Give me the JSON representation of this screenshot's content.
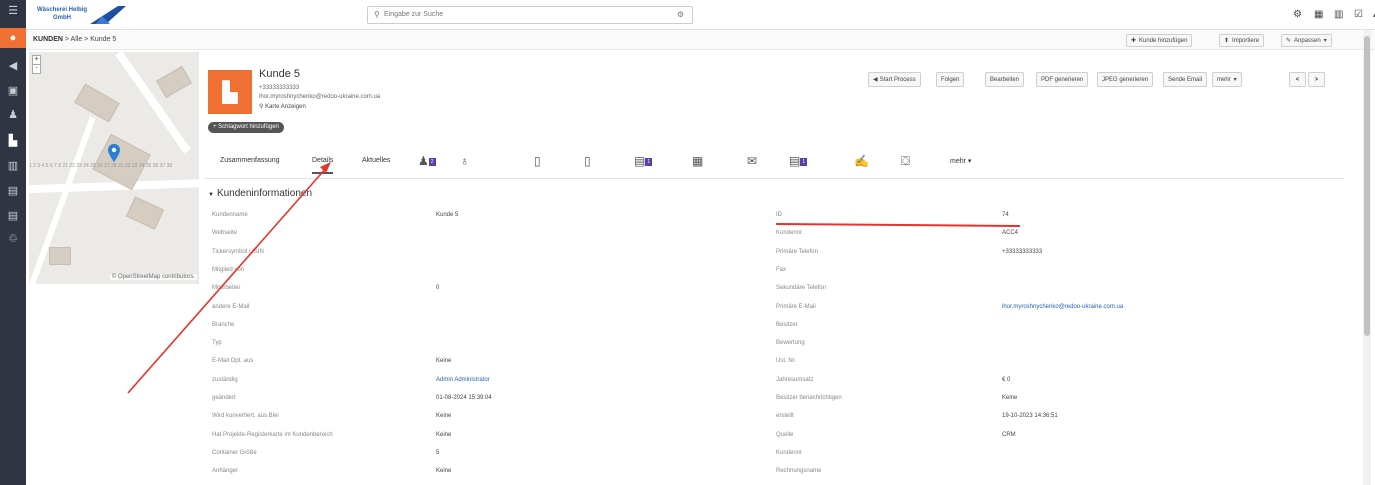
{
  "brand": {
    "line1": "Wäscherei Helbig",
    "line2": "GmbH"
  },
  "search": {
    "placeholder": "Eingabe zur Suche"
  },
  "breadcrumb": {
    "module": "KUNDEN",
    "path": "> Alle > Kunde 5"
  },
  "toolbar": {
    "add": "Kunde hinzufügen",
    "import": "Importiere",
    "customize": "Anpassen"
  },
  "map": {
    "attribution": "© OpenStreetMap contributors.",
    "zoom_in": "+",
    "zoom_out": "-"
  },
  "record": {
    "name": "Kunde 5",
    "phone": "+33333333333",
    "email": "ihor.myroshnychenko@redoo-ukraine.com.ua",
    "map_link": "Karte Anzeigen",
    "tag_button": "+ Schlagwort hinzufügen"
  },
  "actions": {
    "start_process": "Start Process",
    "follow": "Folgen",
    "edit": "Bearbeiten",
    "pdf": "PDF generieren",
    "jpeg": "JPEG generieren",
    "send_email": "Sende Email",
    "more": "mehr"
  },
  "tabs": {
    "summary": "Zusammenfassung",
    "details": "Details",
    "updates": "Aktuelles",
    "more": "mehr",
    "badge1": "2",
    "badge2": "1",
    "badge3": "1"
  },
  "section": {
    "title": "Kundeninformationen"
  },
  "fields_left": [
    {
      "label": "Kundenname",
      "value": "Kunde 5"
    },
    {
      "label": "Webseite",
      "value": ""
    },
    {
      "label": "Tickersymbol / ISIN",
      "value": ""
    },
    {
      "label": "Mitglied von",
      "value": ""
    },
    {
      "label": "Mitarbeiter",
      "value": "0"
    },
    {
      "label": "andere E-Mail",
      "value": ""
    },
    {
      "label": "Branche",
      "value": ""
    },
    {
      "label": "Typ",
      "value": ""
    },
    {
      "label": "E-Mail Opt. aus",
      "value": "Keine"
    },
    {
      "label": "zuständig",
      "value": "Admin Administrator"
    },
    {
      "label": "geändert",
      "value": "01-08-2024 15:39:04"
    },
    {
      "label": "Wird konvertiert, aus Blei",
      "value": "Keine"
    },
    {
      "label": "Hat Projekte-Registerkarte im Kundenbereich",
      "value": "Keine"
    },
    {
      "label": "Container Größe",
      "value": "5"
    },
    {
      "label": "Anhänger",
      "value": "Keine"
    }
  ],
  "fields_right": [
    {
      "label": "ID",
      "value": "74"
    },
    {
      "label": "Kundennr.",
      "value": "ACC4"
    },
    {
      "label": "Primäre Telefon",
      "value": "+33333333333"
    },
    {
      "label": "Fax",
      "value": ""
    },
    {
      "label": "Sekundäre Telefon",
      "value": ""
    },
    {
      "label": "Primäre E-Mail",
      "value": "ihor.myroshnychenko@redoo-ukraine.com.ua"
    },
    {
      "label": "Besitzer",
      "value": ""
    },
    {
      "label": "Bewertung",
      "value": ""
    },
    {
      "label": "Ust. Nr.",
      "value": ""
    },
    {
      "label": "Jahresumsatz",
      "value": "€ 0"
    },
    {
      "label": "Besitzer benachrichtigen",
      "value": "Keine"
    },
    {
      "label": "erstellt",
      "value": "19-10-2023 14:36:51"
    },
    {
      "label": "Quelle",
      "value": "CRM"
    },
    {
      "label": "Kundennr.",
      "value": ""
    },
    {
      "label": "Rechnungsname",
      "value": ""
    }
  ],
  "colors": {
    "accent": "#f07033",
    "sidebar": "#2f3542",
    "annotation": "#e8322d",
    "link": "#2b5fae"
  }
}
